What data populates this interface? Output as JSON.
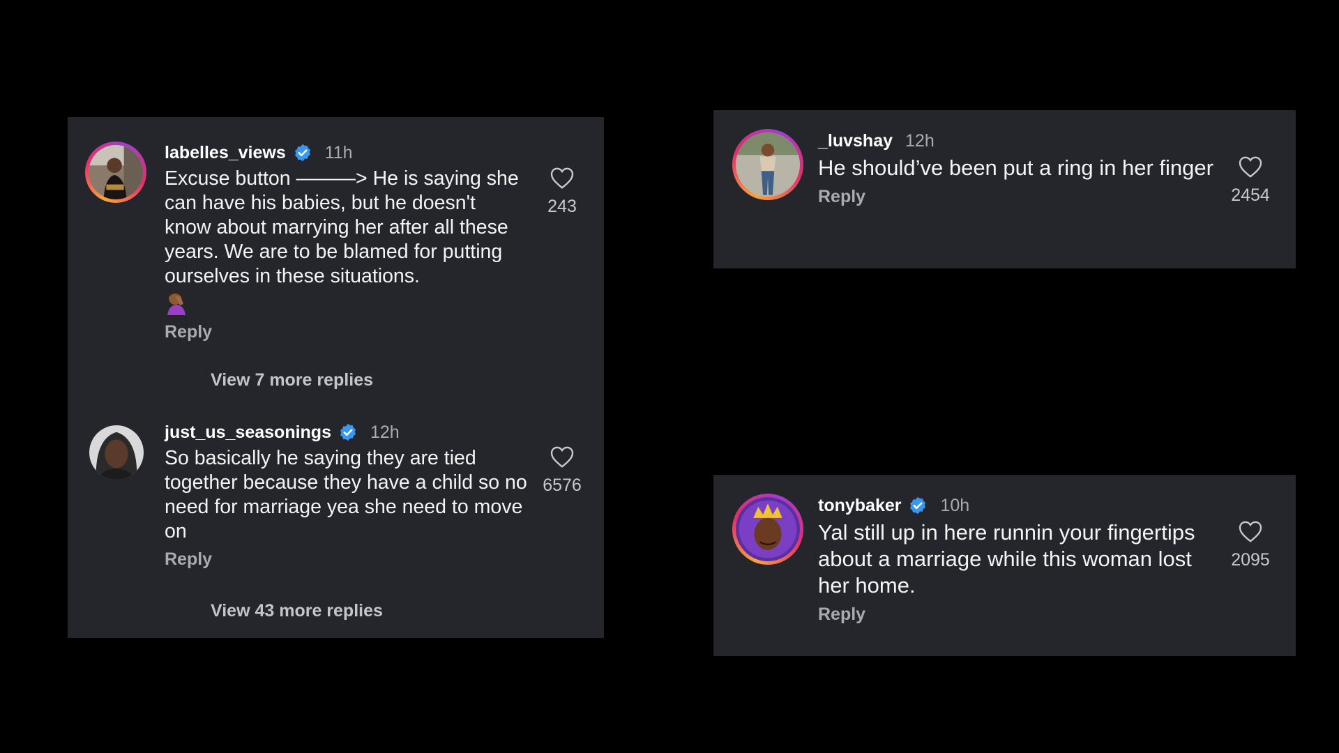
{
  "colors": {
    "background": "#000000",
    "panel": "#25262b",
    "verified": "#3897f0",
    "muted_text": "#a9abb1"
  },
  "left_panel": {
    "comments": [
      {
        "username": "labelles_views",
        "verified": true,
        "time": "11h",
        "text": "Excuse button ———> He is saying she can have his babies, but he doesn't know about marrying her after all these years. We are to be blamed for putting ourselves in these situations.",
        "emoji": "🤦🏾‍♀️",
        "reply_label": "Reply",
        "likes": "243",
        "view_more": "View 7 more replies",
        "avatar_icon": "profile-photo-icon",
        "like_icon": "heart-outline-icon"
      },
      {
        "username": "just_us_seasonings",
        "verified": true,
        "time": "12h",
        "text": "So basically he saying they are tied together because they have a child so no need for marriage yea she need to move on",
        "reply_label": "Reply",
        "likes": "6576",
        "view_more": "View 43 more replies",
        "avatar_icon": "profile-photo-icon",
        "like_icon": "heart-outline-icon"
      }
    ]
  },
  "top_right_panel": {
    "comment": {
      "username": "_luvshay",
      "verified": false,
      "time": "12h",
      "text": "He should’ve been put a ring in her finger",
      "reply_label": "Reply",
      "likes": "2454",
      "avatar_icon": "profile-photo-icon",
      "like_icon": "heart-outline-icon"
    }
  },
  "bottom_right_panel": {
    "comment": {
      "username": "tonybaker",
      "verified": true,
      "time": "10h",
      "text": "Yal still up in here runnin your fingertips about a marriage while this woman lost her home.",
      "reply_label": "Reply",
      "likes": "2095",
      "avatar_icon": "profile-photo-icon",
      "like_icon": "heart-outline-icon"
    }
  }
}
